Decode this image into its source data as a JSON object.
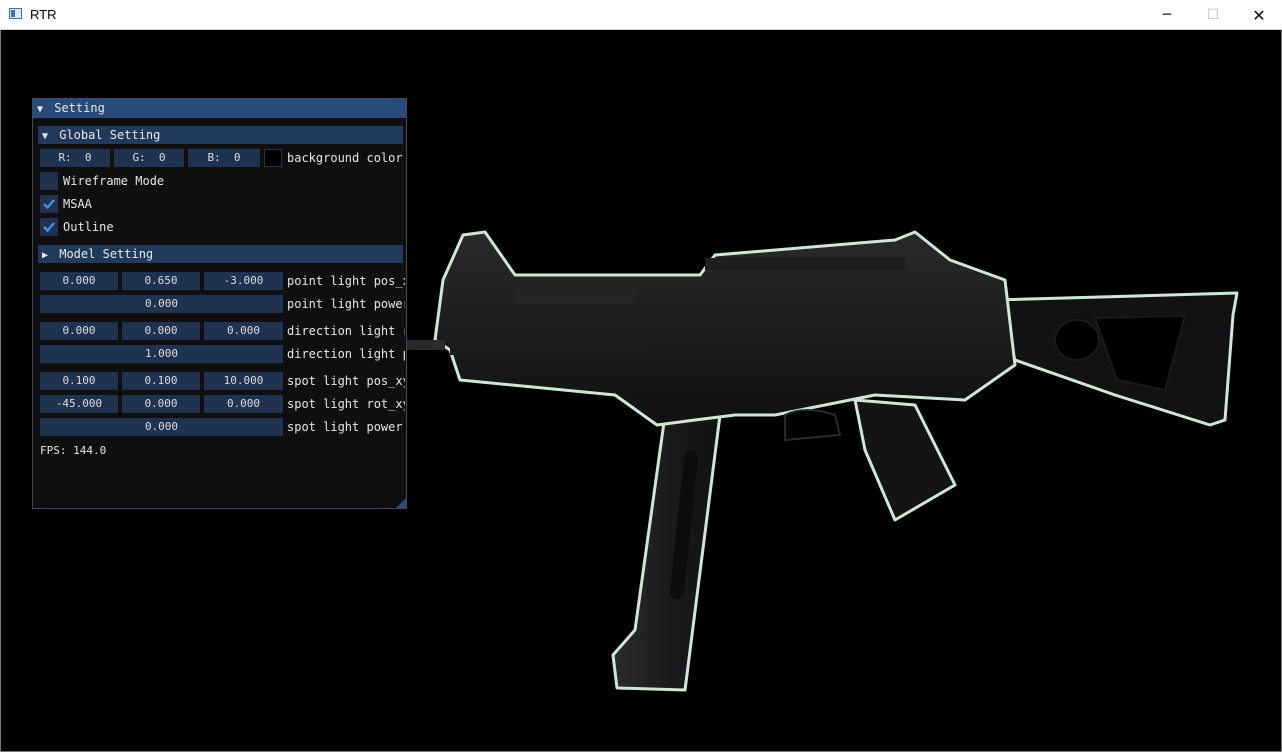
{
  "window": {
    "title": "RTR",
    "min_glyph": "─",
    "max_glyph": "☐",
    "close_glyph": "✕"
  },
  "panel": {
    "title": "Setting",
    "global": {
      "title": "Global Setting",
      "r_text": "R:  0",
      "g_text": "G:  0",
      "b_text": "B:  0",
      "bg_label": "background color",
      "background_color": "#000000",
      "wireframe_label": "Wireframe Mode",
      "wireframe_checked": false,
      "msaa_label": "MSAA",
      "msaa_checked": true,
      "outline_label": "Outline",
      "outline_checked": true
    },
    "model": {
      "title": "Model Setting",
      "point_pos": [
        "0.000",
        "0.650",
        "-3.000"
      ],
      "point_pos_label": "point light pos_x",
      "point_power": "0.000",
      "point_power_label": "point light power",
      "dir_rot": [
        "0.000",
        "0.000",
        "0.000"
      ],
      "dir_rot_label": "direction light r",
      "dir_power": "1.000",
      "dir_power_label": "direction light p",
      "spot_pos": [
        "0.100",
        "0.100",
        "10.000"
      ],
      "spot_pos_label": "spot light pos_xy",
      "spot_rot": [
        "-45.000",
        "0.000",
        "0.000"
      ],
      "spot_rot_label": "spot light rot_xy",
      "spot_power": "0.000",
      "spot_power_label": "spot light power"
    },
    "fps": "FPS: 144.0"
  },
  "colors": {
    "accent": "#294a7a",
    "header": "#213a5c",
    "frame_bg": "#1f3351",
    "check": "#4a90e2",
    "outline_glow": "#cfe8d4"
  }
}
